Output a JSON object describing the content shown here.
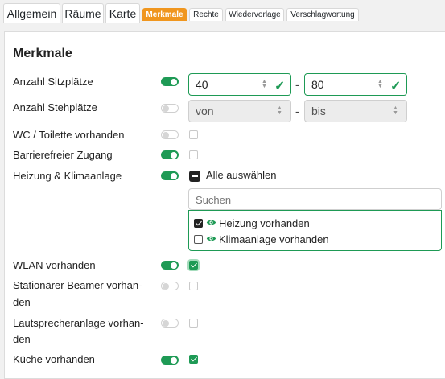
{
  "tabs": [
    {
      "label": "Allgemein"
    },
    {
      "label": "Räume"
    },
    {
      "label": "Karte"
    },
    {
      "label": "Merkmale",
      "active": true
    },
    {
      "label": "Rechte"
    },
    {
      "label": "Wiedervorlage"
    },
    {
      "label": "Verschlagwortung"
    }
  ],
  "section_title": "Merkmale",
  "rows": {
    "sitzplaetze": {
      "label": "Anzahl Sitzplätze",
      "enabled": true,
      "from": "40",
      "to": "80"
    },
    "stehplaetze": {
      "label": "Anzahl Stehplätze",
      "enabled": false,
      "from": "von",
      "to": "bis"
    },
    "wc": {
      "label": "WC / Toilette vorhanden",
      "enabled": false,
      "checked": false
    },
    "barrierefrei": {
      "label": "Barrierefreier Zugang",
      "enabled": true,
      "checked": false
    },
    "heizung": {
      "label": "Heizung & Klimaanlage",
      "enabled": true
    },
    "wlan": {
      "label": "WLAN vorhanden",
      "enabled": true,
      "checked": true
    },
    "beamer": {
      "label_line1": "Stationärer Beamer vorhan-",
      "label_line2": "den",
      "enabled": false,
      "checked": false
    },
    "lautsprecher": {
      "label_line1": "Lautsprecheranlage vorhan-",
      "label_line2": "den",
      "enabled": false,
      "checked": false
    },
    "kueche": {
      "label": "Küche vorhanden",
      "enabled": true,
      "checked": true
    }
  },
  "range_separator": "-",
  "multiselect": {
    "select_all_label": "Alle auswählen",
    "search_placeholder": "Suchen",
    "options": [
      {
        "label": "Heizung vorhanden",
        "checked": true,
        "icon": "eye-icon"
      },
      {
        "label": "Klimaanlage vorhanden",
        "checked": false,
        "icon": "eye-icon"
      }
    ]
  },
  "colors": {
    "accent": "#f0961e",
    "success": "#1e9a55"
  }
}
